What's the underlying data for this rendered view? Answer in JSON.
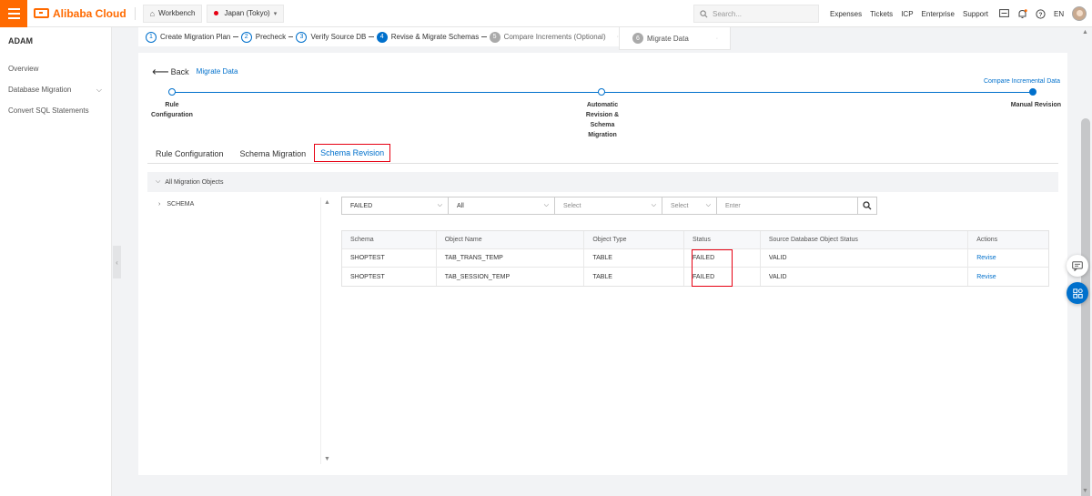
{
  "topbar": {
    "brand": "Alibaba Cloud",
    "workbench": "Workbench",
    "region": "Japan (Tokyo)",
    "search_placeholder": "Search...",
    "links": [
      "Expenses",
      "Tickets",
      "ICP",
      "Enterprise",
      "Support"
    ],
    "lang": "EN"
  },
  "sidebar": {
    "title": "ADAM",
    "items": [
      {
        "label": "Overview"
      },
      {
        "label": "Database Migration"
      },
      {
        "label": "Convert SQL Statements"
      }
    ]
  },
  "steps": {
    "items": [
      {
        "num": "1",
        "label": "Create Migration Plan"
      },
      {
        "num": "2",
        "label": "Precheck"
      },
      {
        "num": "3",
        "label": "Verify Source DB"
      },
      {
        "num": "4",
        "label": "Revise & Migrate Schemas"
      },
      {
        "num": "5",
        "label": "Compare Increments (Optional)"
      },
      {
        "num": "6",
        "label": "Migrate Data"
      }
    ]
  },
  "card": {
    "back_label": "Back",
    "breadcrumb": "Migrate Data",
    "progress": {
      "start_label_1": "Rule",
      "start_label_2": "Configuration",
      "mid_label_1": "Automatic",
      "mid_label_2": "Revision &",
      "mid_label_3": "Schema",
      "mid_label_4": "Migration",
      "top_right_label": "Compare Incremental Data",
      "end_label": "Manual Revision"
    },
    "tabs": [
      {
        "label": "Rule Configuration"
      },
      {
        "label": "Schema Migration"
      },
      {
        "label": "Schema Revision"
      }
    ],
    "objects_header": "All Migration Objects",
    "tree_item": "SCHEMA",
    "filters": {
      "status": "FAILED",
      "type": "All",
      "select1": "Select",
      "select2": "Select",
      "input_placeholder": "Enter"
    },
    "table": {
      "headers": [
        "Schema",
        "Object Name",
        "Object Type",
        "Status",
        "Source Database Object Status",
        "Actions"
      ],
      "rows": [
        {
          "schema": "SHOPTEST",
          "object_name": "TAB_TRANS_TEMP",
          "object_type": "TABLE",
          "status": "FAILED",
          "source_status": "VALID",
          "action": "Revise"
        },
        {
          "schema": "SHOPTEST",
          "object_name": "TAB_SESSION_TEMP",
          "object_type": "TABLE",
          "status": "FAILED",
          "source_status": "VALID",
          "action": "Revise"
        }
      ]
    }
  },
  "colors": {
    "brand": "#ff6a00",
    "accent": "#0070cc",
    "highlight": "#e60012"
  }
}
